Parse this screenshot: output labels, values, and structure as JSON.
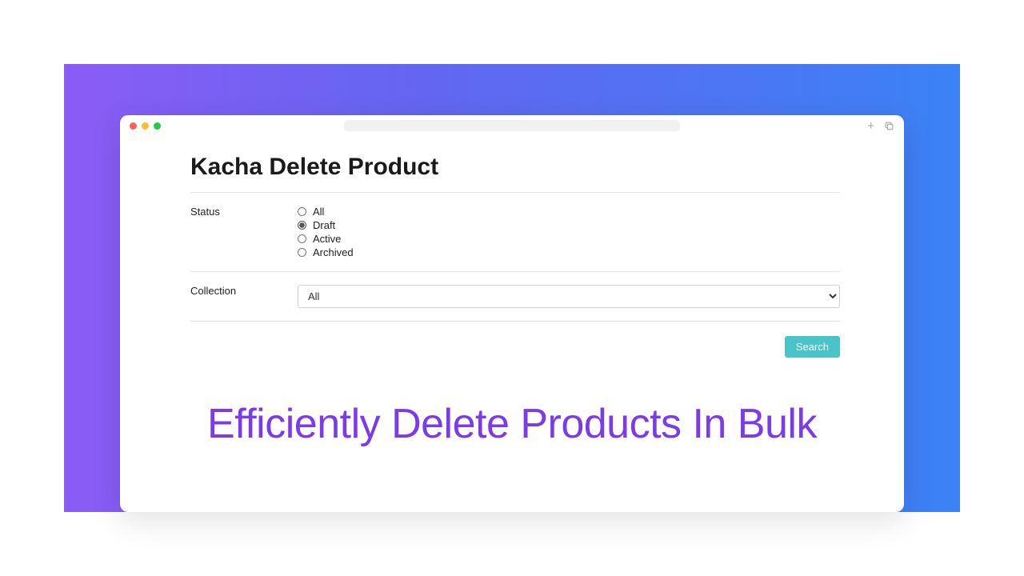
{
  "page": {
    "title": "Kacha Delete Product",
    "tagline": "Efficiently Delete Products In Bulk"
  },
  "form": {
    "status": {
      "label": "Status",
      "options": [
        "All",
        "Draft",
        "Active",
        "Archived"
      ],
      "selected": "Draft"
    },
    "collection": {
      "label": "Collection",
      "value": "All"
    },
    "search_label": "Search"
  },
  "titlebar": {
    "new_tab": "+"
  }
}
